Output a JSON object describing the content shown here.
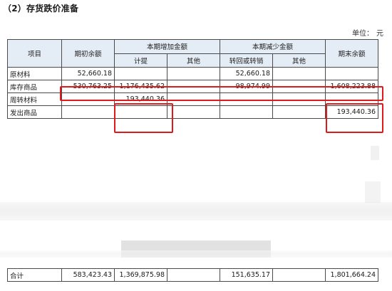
{
  "section_title": "（2）存货跌价准备",
  "unit": {
    "label": "单位：",
    "value": "元"
  },
  "header": {
    "item": "项目",
    "opening": "期初余额",
    "increase_group": "本期增加金额",
    "increase_accrual": "计提",
    "increase_other": "其他",
    "decrease_group": "本期减少金额",
    "decrease_reversal": "转回或转销",
    "decrease_other": "其他",
    "closing": "期末余额"
  },
  "rows": [
    {
      "item": "原材料",
      "opening": "52,660.18",
      "accrual": "",
      "inc_other": "",
      "reversal": "52,660.18",
      "dec_other": "",
      "closing": ""
    },
    {
      "item": "库存商品",
      "opening": "530,763.25",
      "accrual": "1,176,435.62",
      "inc_other": "",
      "reversal": "98,974.99",
      "dec_other": "",
      "closing": "1,608,223.88"
    },
    {
      "item": "周转材料",
      "opening": "",
      "accrual": "193,440.36",
      "inc_other": "",
      "reversal": "",
      "dec_other": "",
      "closing": ""
    },
    {
      "item": "发出商品",
      "opening": "",
      "accrual": "",
      "inc_other": "",
      "reversal": "",
      "dec_other": "",
      "closing": "193,440.36"
    }
  ],
  "total": {
    "item": "合计",
    "opening": "583,423.43",
    "accrual": "1,369,875.98",
    "inc_other": "",
    "reversal": "151,635.17",
    "dec_other": "",
    "closing": "1,801,664.24"
  },
  "highlight_color": "#e0191b"
}
